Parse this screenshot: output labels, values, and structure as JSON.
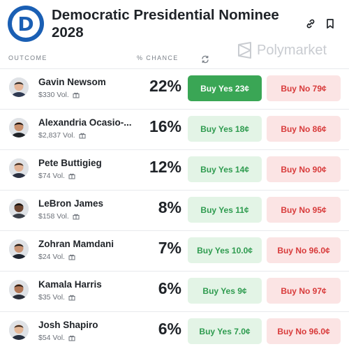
{
  "market": {
    "title": "Democratic Presidential Nominee 2028",
    "logo_letter": "D",
    "logo_color": "#1a5fb4"
  },
  "header_icons": [
    "link-icon",
    "bookmark-icon"
  ],
  "columns": {
    "outcome": "OUTCOME",
    "chance": "% CHANCE"
  },
  "watermark": "Polymarket",
  "colors": {
    "yes_active": "#3aa655",
    "yes": "#2e9b4f",
    "no": "#d83a3a"
  },
  "outcomes": [
    {
      "name": "Gavin Newsom",
      "volume": "$330 Vol.",
      "chance": "22%",
      "buy_yes": "Buy Yes 23¢",
      "buy_no": "Buy No 79¢",
      "highlighted": true
    },
    {
      "name": "Alexandria Ocasio-...",
      "volume": "$2,837 Vol.",
      "chance": "16%",
      "buy_yes": "Buy Yes 18¢",
      "buy_no": "Buy No 86¢"
    },
    {
      "name": "Pete Buttigieg",
      "volume": "$74 Vol.",
      "chance": "12%",
      "buy_yes": "Buy Yes 14¢",
      "buy_no": "Buy No 90¢"
    },
    {
      "name": "LeBron James",
      "volume": "$158 Vol.",
      "chance": "8%",
      "buy_yes": "Buy Yes 11¢",
      "buy_no": "Buy No 95¢"
    },
    {
      "name": "Zohran Mamdani",
      "volume": "$24 Vol.",
      "chance": "7%",
      "buy_yes": "Buy Yes 10.0¢",
      "buy_no": "Buy No 96.0¢"
    },
    {
      "name": "Kamala Harris",
      "volume": "$35 Vol.",
      "chance": "6%",
      "buy_yes": "Buy Yes 9¢",
      "buy_no": "Buy No 97¢"
    },
    {
      "name": "Josh Shapiro",
      "volume": "$54 Vol.",
      "chance": "6%",
      "buy_yes": "Buy Yes 7.0¢",
      "buy_no": "Buy No 96.0¢"
    }
  ]
}
